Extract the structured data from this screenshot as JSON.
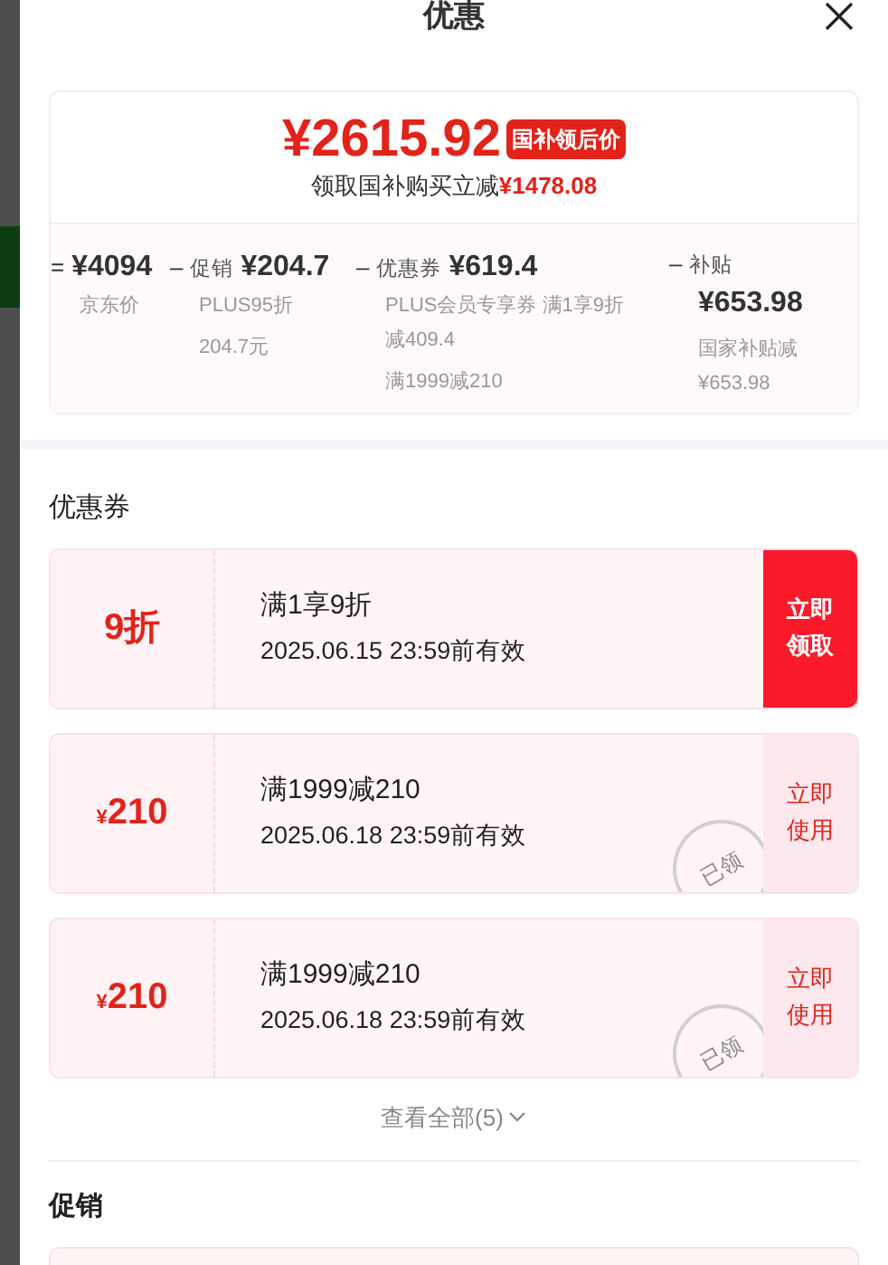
{
  "dialog": {
    "title": "优惠"
  },
  "summary": {
    "price": "¥2615.92",
    "badge": "国补领后价",
    "saving_text": "领取国补购买立减",
    "saving_amount": "¥1478.08",
    "breakdown": [
      {
        "op": "=",
        "value": "¥4094",
        "value_below": false,
        "notes": [
          "京东价"
        ]
      },
      {
        "op": "–",
        "label": "促销",
        "value": "¥204.7",
        "value_below": false,
        "notes": [
          "PLUS95折",
          "204.7元"
        ]
      },
      {
        "op": "–",
        "label": "优惠券",
        "value": "¥619.4",
        "value_below": false,
        "notes": [
          "PLUS会员专享券 满1享9折减409.4",
          "满1999减210"
        ]
      },
      {
        "op": "–",
        "label": "补贴",
        "value": "¥653.98",
        "value_below": true,
        "notes": [
          "国家补贴减¥653.98"
        ]
      }
    ]
  },
  "coupons_section": {
    "heading": "优惠券",
    "more": "查看全部(5)",
    "coupons": [
      {
        "amount": "9折",
        "title": "满1享9折",
        "validity": "2025.06.15 23:59前有效",
        "claimed": false,
        "action": "立即领取"
      },
      {
        "currency": "¥",
        "amount": "210",
        "title": "满1999减210",
        "validity": "2025.06.18 23:59前有效",
        "claimed": true,
        "stamp": "已领",
        "action": "立即使用"
      },
      {
        "currency": "¥",
        "amount": "210",
        "title": "满1999减210",
        "validity": "2025.06.18 23:59前有效",
        "claimed": true,
        "stamp": "已领",
        "action": "立即使用"
      }
    ]
  },
  "promotions_section": {
    "heading": "促销"
  }
}
